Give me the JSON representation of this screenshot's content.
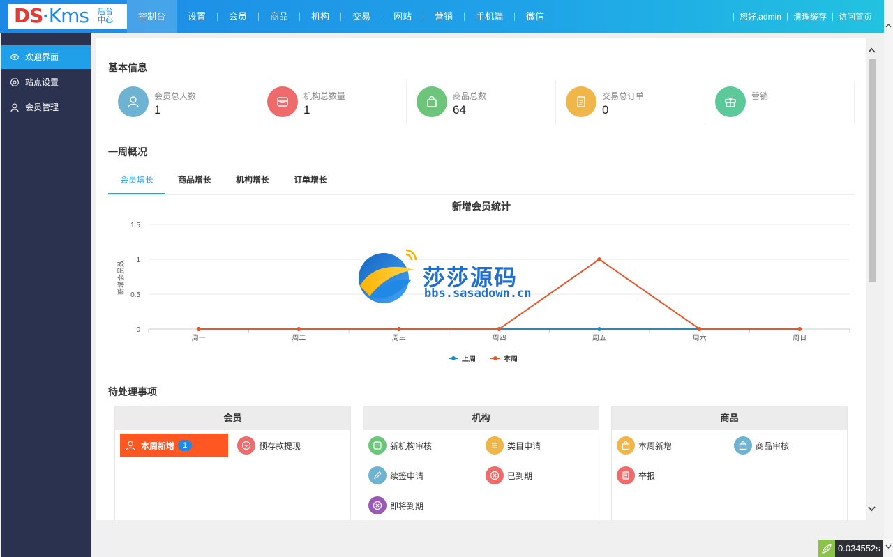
{
  "app": {
    "logo_brand_left": "DS",
    "logo_brand_right": "Kms",
    "logo_sub_line1": "后台",
    "logo_sub_line2": "中心"
  },
  "topnav": {
    "items": [
      "控制台",
      "设置",
      "会员",
      "商品",
      "机构",
      "交易",
      "网站",
      "营销",
      "手机端",
      "微信"
    ],
    "active_index": 0
  },
  "top_right": {
    "greeting": "您好,admin",
    "clear_cache": "清理缓存",
    "visit_home": "访问首页"
  },
  "sidebar": {
    "items": [
      {
        "label": "欢迎界面",
        "icon": "eye-icon"
      },
      {
        "label": "站点设置",
        "icon": "gear-icon"
      },
      {
        "label": "会员管理",
        "icon": "user-icon"
      }
    ],
    "active_index": 0
  },
  "basic_info": {
    "title": "基本信息",
    "stats": [
      {
        "label": "会员总人数",
        "value": "1",
        "color": "#6fb3d2",
        "icon": "user-icon"
      },
      {
        "label": "机构总数量",
        "value": "1",
        "color": "#ef6b6b",
        "icon": "store-icon"
      },
      {
        "label": "商品总数",
        "value": "64",
        "color": "#6cc57a",
        "icon": "bag-icon"
      },
      {
        "label": "交易总订单",
        "value": "0",
        "color": "#f0b64a",
        "icon": "document-icon"
      },
      {
        "label": "营销",
        "value": "",
        "color": "#5cc99a",
        "icon": "gift-icon"
      }
    ]
  },
  "weekly": {
    "title": "一周概况",
    "tabs": [
      "会员增长",
      "商品增长",
      "机构增长",
      "订单增长"
    ],
    "active_tab": 0
  },
  "watermark": {
    "cn": "莎莎源码",
    "url": "bbs.sasadown.cn"
  },
  "chart_data": {
    "type": "line",
    "title": "新增会员统计",
    "ylabel": "新增会员数",
    "xlabel": "",
    "categories": [
      "周一",
      "周二",
      "周三",
      "周四",
      "周五",
      "周六",
      "周日"
    ],
    "yticks": [
      "0",
      "0.5",
      "1",
      "1.5"
    ],
    "ylim": [
      0,
      1.5
    ],
    "series": [
      {
        "name": "上周",
        "color": "#1e8bc3",
        "values": [
          0,
          0,
          0,
          0,
          0,
          0,
          0
        ]
      },
      {
        "name": "本周",
        "color": "#e2592b",
        "values": [
          0,
          0,
          0,
          0,
          1,
          0,
          0
        ]
      }
    ],
    "legend_position": "bottom-center",
    "grid": true
  },
  "pending": {
    "title": "待处理事项",
    "groups": [
      {
        "title": "会员",
        "items": [
          {
            "label": "本周新增",
            "badge": "1",
            "color": "#ff5722",
            "icon": "user-icon"
          },
          {
            "label": "预存款提现",
            "color": "#ef6b6b",
            "icon": "withdraw-icon"
          }
        ]
      },
      {
        "title": "机构",
        "items": [
          {
            "label": "新机构审核",
            "color": "#6cc57a",
            "icon": "store-icon"
          },
          {
            "label": "类目申请",
            "color": "#f0b64a",
            "icon": "list-icon"
          },
          {
            "label": "续签申请",
            "color": "#6fb3d2",
            "icon": "pen-icon"
          },
          {
            "label": "已到期",
            "color": "#ef6b6b",
            "icon": "close-circle-icon"
          },
          {
            "label": "即将到期",
            "color": "#9b59b6",
            "icon": "close-circle-icon"
          }
        ]
      },
      {
        "title": "商品",
        "items": [
          {
            "label": "本周新增",
            "color": "#f0b64a",
            "icon": "bag-icon"
          },
          {
            "label": "商品审核",
            "color": "#6fb3d2",
            "icon": "bag-icon"
          },
          {
            "label": "举报",
            "color": "#ef6b6b",
            "icon": "report-icon"
          }
        ]
      }
    ]
  },
  "timer": {
    "value": "0.034552s"
  }
}
